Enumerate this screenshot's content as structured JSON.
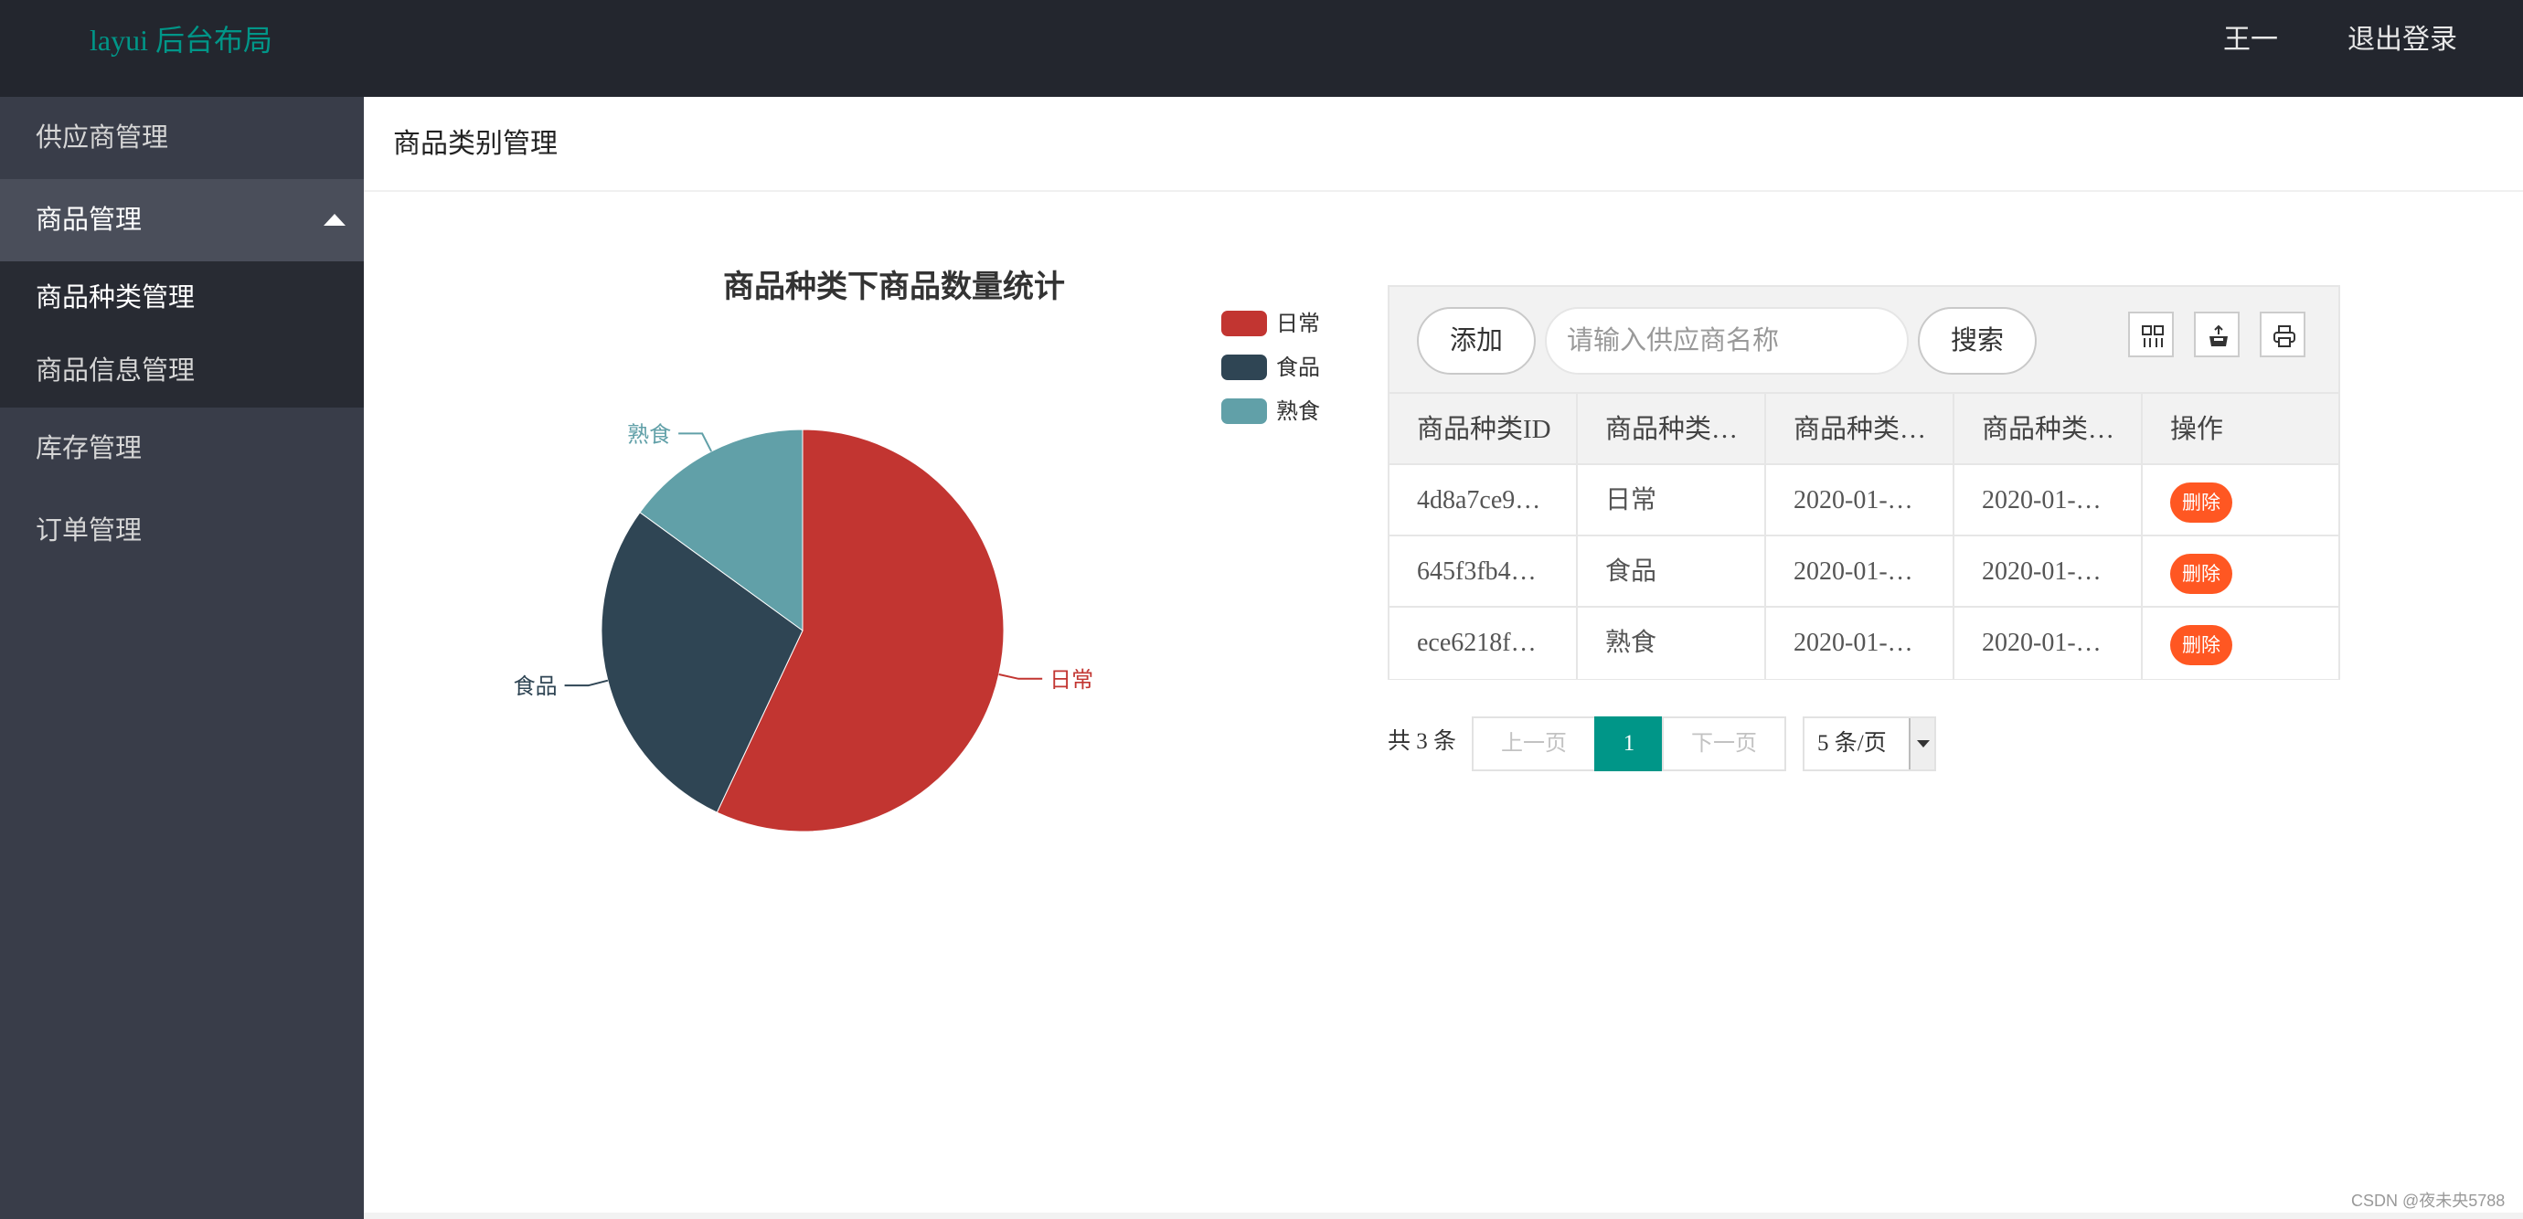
{
  "header": {
    "logo": "layui 后台布局",
    "user": "王一",
    "logout": "退出登录"
  },
  "sidebar": {
    "items": [
      {
        "label": "供应商管理"
      },
      {
        "label": "商品管理",
        "expanded": true,
        "children": [
          {
            "label": "商品种类管理",
            "current": true
          },
          {
            "label": "商品信息管理"
          }
        ]
      },
      {
        "label": "库存管理"
      },
      {
        "label": "订单管理"
      }
    ]
  },
  "page": {
    "title": "商品类别管理"
  },
  "chart_data": {
    "type": "pie",
    "title": "商品种类下商品数量统计",
    "legend_position": "top-right",
    "slices": [
      {
        "name": "日常",
        "value": 57,
        "color": "#c23531"
      },
      {
        "name": "食品",
        "value": 28,
        "color": "#2f4554"
      },
      {
        "name": "熟食",
        "value": 15,
        "color": "#61a0a8"
      }
    ]
  },
  "toolbar": {
    "add_label": "添加",
    "search_placeholder": "请输入供应商名称",
    "search_label": "搜索",
    "icons": [
      "columns-icon",
      "export-icon",
      "print-icon"
    ]
  },
  "table": {
    "headers": [
      "商品种类ID",
      "商品种类…",
      "商品种类…",
      "商品种类…",
      "操作"
    ],
    "rows": [
      {
        "id": "4d8a7ce9…",
        "name": "日常",
        "c3": "2020-01-…",
        "c4": "2020-01-…",
        "action": "删除"
      },
      {
        "id": "645f3fb4…",
        "name": "食品",
        "c3": "2020-01-…",
        "c4": "2020-01-…",
        "action": "删除"
      },
      {
        "id": "ece6218f…",
        "name": "熟食",
        "c3": "2020-01-…",
        "c4": "2020-01-…",
        "action": "删除"
      }
    ]
  },
  "pagination": {
    "total": "共 3 条",
    "prev": "上一页",
    "current": "1",
    "next": "下一页",
    "page_size": "5 条/页"
  },
  "watermark": "CSDN @夜未央5788",
  "colors": {
    "accent": "#009688",
    "header_bg": "#23262e",
    "sidebar_bg": "#393d49",
    "danger": "#ff5722"
  }
}
